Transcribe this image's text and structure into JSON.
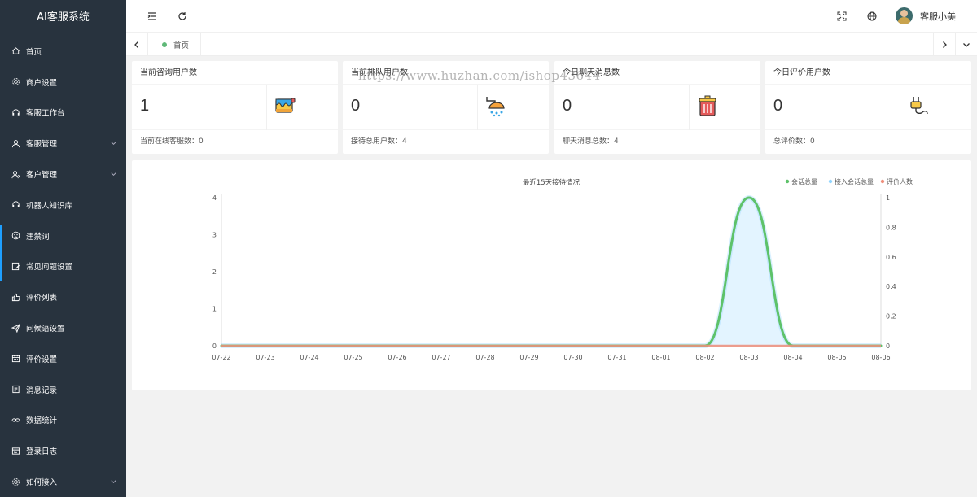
{
  "app": {
    "title": "AI客服系统"
  },
  "sidebar": {
    "items": [
      {
        "label": "首页",
        "icon": "home-icon",
        "has_arrow": false
      },
      {
        "label": "商户设置",
        "icon": "gear-icon",
        "has_arrow": false
      },
      {
        "label": "客服工作台",
        "icon": "headset-icon",
        "has_arrow": false
      },
      {
        "label": "客服管理",
        "icon": "user-icon",
        "has_arrow": true
      },
      {
        "label": "客户管理",
        "icon": "user-group-icon",
        "has_arrow": true
      },
      {
        "label": "机器人知识库",
        "icon": "headset-icon",
        "has_arrow": false
      },
      {
        "label": "违禁词",
        "icon": "face-icon",
        "has_arrow": false
      },
      {
        "label": "常见问题设置",
        "icon": "edit-icon",
        "has_arrow": false
      },
      {
        "label": "评价列表",
        "icon": "thumbs-up-icon",
        "has_arrow": false
      },
      {
        "label": "问候语设置",
        "icon": "send-icon",
        "has_arrow": false
      },
      {
        "label": "评价设置",
        "icon": "calendar-icon",
        "has_arrow": false
      },
      {
        "label": "消息记录",
        "icon": "note-icon",
        "has_arrow": false
      },
      {
        "label": "数据统计",
        "icon": "link-icon",
        "has_arrow": false
      },
      {
        "label": "登录日志",
        "icon": "log-icon",
        "has_arrow": false
      },
      {
        "label": "如何接入",
        "icon": "gear-icon",
        "has_arrow": true
      }
    ]
  },
  "header": {
    "user_name": "客服小美"
  },
  "tabs": {
    "home_label": "首页"
  },
  "watermark": "https://www.huzhan.com/ishop43644",
  "cards": [
    {
      "title": "当前咨询用户数",
      "value": "1",
      "footer": "当前在线客服数：0",
      "icon": "paint-bucket-icon"
    },
    {
      "title": "当前排队用户数",
      "value": "0",
      "footer": "接待总用户数：4",
      "icon": "shower-icon"
    },
    {
      "title": "今日聊天消息数",
      "value": "0",
      "footer": "聊天消息总数：4",
      "icon": "trash-bin-icon"
    },
    {
      "title": "今日评价用户数",
      "value": "0",
      "footer": "总评价数：0",
      "icon": "plug-icon"
    }
  ],
  "colors": {
    "sidebar_bg": "#28333e",
    "accent_blue": "#1e9fff",
    "green_dot": "#5fb878",
    "series_total": "#5ec26a",
    "series_accepted": "#91d5ff",
    "series_rating": "#ef8f7c"
  },
  "chart_data": {
    "type": "line",
    "title": "最近15天接待情况",
    "categories": [
      "07-22",
      "07-23",
      "07-24",
      "07-25",
      "07-26",
      "07-27",
      "07-28",
      "07-29",
      "07-30",
      "07-31",
      "08-01",
      "08-02",
      "08-03",
      "08-04",
      "08-05",
      "08-06"
    ],
    "series": [
      {
        "name": "会话总量",
        "axis": "left",
        "values": [
          0,
          0,
          0,
          0,
          0,
          0,
          0,
          0,
          0,
          0,
          0,
          0,
          4,
          0,
          0,
          0
        ]
      },
      {
        "name": "接入会话总量",
        "axis": "left",
        "values": [
          0,
          0,
          0,
          0,
          0,
          0,
          0,
          0,
          0,
          0,
          0,
          0,
          4,
          0,
          0,
          0
        ]
      },
      {
        "name": "评价人数",
        "axis": "right",
        "values": [
          0,
          0,
          0,
          0,
          0,
          0,
          0,
          0,
          0,
          0,
          0,
          0,
          0,
          0,
          0,
          0
        ]
      }
    ],
    "left_axis": {
      "ticks": [
        "0",
        "1",
        "2",
        "3",
        "4"
      ],
      "ylim": [
        0,
        4
      ]
    },
    "right_axis": {
      "ticks": [
        "0",
        "0.2",
        "0.4",
        "0.6",
        "0.8",
        "1"
      ],
      "ylim": [
        0,
        1
      ]
    },
    "smooth": true,
    "legend_position": "top-right",
    "grid": false
  }
}
